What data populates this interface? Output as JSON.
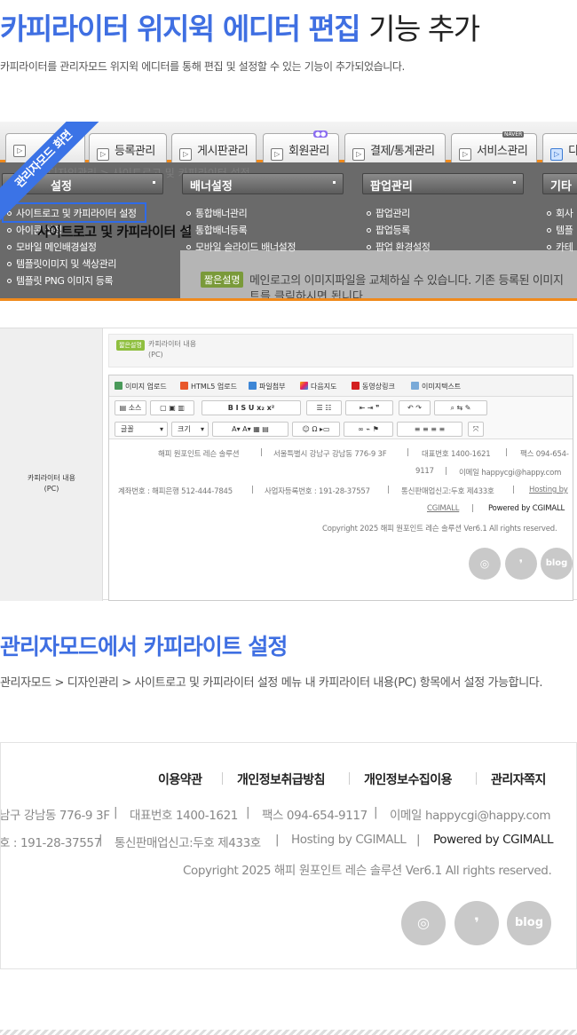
{
  "header": {
    "title_highlight": "카피라이터 위지윅 에디터 편집",
    "title_rest": "기능 추가",
    "subtitle": "카피라이터를 관리자모드 위지윅 에디터를 통해 편집 및 설정할 수 있는 기능이 추가되었습니다."
  },
  "admin_screen": {
    "ribbon": "관리자모드 화면",
    "tabs": [
      "",
      "등록관리",
      "게시판관리",
      "회원관리",
      "결제/통계관리",
      "서비스관리",
      "디"
    ],
    "breadcrumb": "> 디자인관리 > 사이트로고 및 카피라이터 설정",
    "menus": [
      {
        "title": "설정",
        "items": [
          "사이트로고 및 카피라이터 설정",
          "아이콘 설정",
          "모바일 메인배경설정",
          "템플릿이미지 및 색상관리",
          "템플릿 PNG 이미지 등록"
        ]
      },
      {
        "title": "배너설정",
        "items": [
          "통합배너관리",
          "통합배너등록",
          "모바일 슬라이드 배너설정"
        ]
      },
      {
        "title": "팝업관리",
        "items": [
          "팝업관리",
          "팝업등록",
          "팝업 환경설정"
        ]
      },
      {
        "title": "기타",
        "items": [
          "회사",
          "템플",
          "카테"
        ]
      }
    ],
    "ghost_title": "사이트로고 및 카피라이터 설",
    "info_button": "짧은설명",
    "info_text": "메인로고의 이미지파일을 교체하실 수 있습니다. 기존 등록된 이미지",
    "info_text2": "트를 클릭하시면 됩니다."
  },
  "editor_screen": {
    "label": "카피라이터 내용\n(PC)",
    "short_button": "짧은설명",
    "short_text": "카피라이터 내용\n(PC)",
    "toolbar1": [
      "이미지 업로드",
      "HTML5 업로드",
      "파일첨부",
      "다음지도",
      "동영상링크",
      "이미지텍스트"
    ],
    "source_label": "소스",
    "font_select": "글꼴",
    "size_select": "크기",
    "footer_lines": {
      "l1a": "해피 원포인트 레슨 솔루션",
      "l1b": "서울특별시 강남구 강남동 776-9 3F",
      "l1c": "대표번호 1400-1621",
      "l1d": "팩스 094-654-",
      "l2a": "9117",
      "l2b": "이메일 happycgi@happy.com",
      "l3a": "계좌번호 : 해피은행 512-444-7845",
      "l3b": "사업자등록번호 : 191-28-37557",
      "l3c": "통신판매업신고:두호 제433호",
      "l3d": "Hosting by",
      "l4a": "CGIMALL",
      "l4b": "Powered by CGIMALL",
      "l5": "Copyright 2025 해피 원포인트 레슨 솔루션 Ver6.1 All rights reserved."
    },
    "social": [
      "instagram-icon",
      "kakao-story-icon",
      "blog-icon"
    ],
    "blog_text": "blog"
  },
  "section2": {
    "title": "관리자모드에서 카피라이트 설정",
    "subtitle": "관리자모드 > 디자인관리 > 사이트로고 및 카피라이터 설정 메뉴 내 카피라이터 내용(PC) 항목에서 설정 가능합니다."
  },
  "footer_preview": {
    "links": [
      "이용약관",
      "개인정보취급방침",
      "개인정보수집이용",
      "관리자쪽지"
    ],
    "line1a": "남구 강남동 776-9 3F",
    "line1b": "대표번호 1400-1621",
    "line1c": "팩스 094-654-9117",
    "line1d": "이메일 happycgi@happy.com",
    "line2a": "호 : 191-28-37557",
    "line2b": "통신판매업신고:두호 제433호",
    "line2c": "Hosting by CGIMALL",
    "line2d": "Powered by CGIMALL",
    "copyright": "Copyright 2025 해피 원포인트 레슨 솔루션 Ver6.1 All rights reserved.",
    "social": [
      "instagram-icon",
      "kakao-story-icon",
      "blog-icon"
    ],
    "blog_text": "blog"
  },
  "colors": {
    "accent": "#3f6fe2",
    "orange": "#f08a1c"
  }
}
